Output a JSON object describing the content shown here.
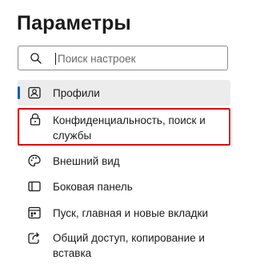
{
  "page": {
    "title": "Параметры"
  },
  "search": {
    "placeholder": "Поиск настроек",
    "value": "",
    "icon": "search-icon"
  },
  "nav": {
    "items": [
      {
        "label": "Профили",
        "icon": "profile-icon",
        "active": true
      },
      {
        "label": "Конфиденциальность, поиск и службы",
        "icon": "lock-icon",
        "highlighted": true
      },
      {
        "label": "Внешний вид",
        "icon": "palette-icon"
      },
      {
        "label": "Боковая панель",
        "icon": "sidebar-icon"
      },
      {
        "label": "Пуск, главная и новые вкладки",
        "icon": "home-tabs-icon"
      },
      {
        "label": "Общий доступ, копирование и вставка",
        "icon": "share-icon"
      }
    ]
  },
  "colors": {
    "accent": "#0a5fb4",
    "highlight_border": "#e0000f",
    "active_background": "#ececec"
  }
}
